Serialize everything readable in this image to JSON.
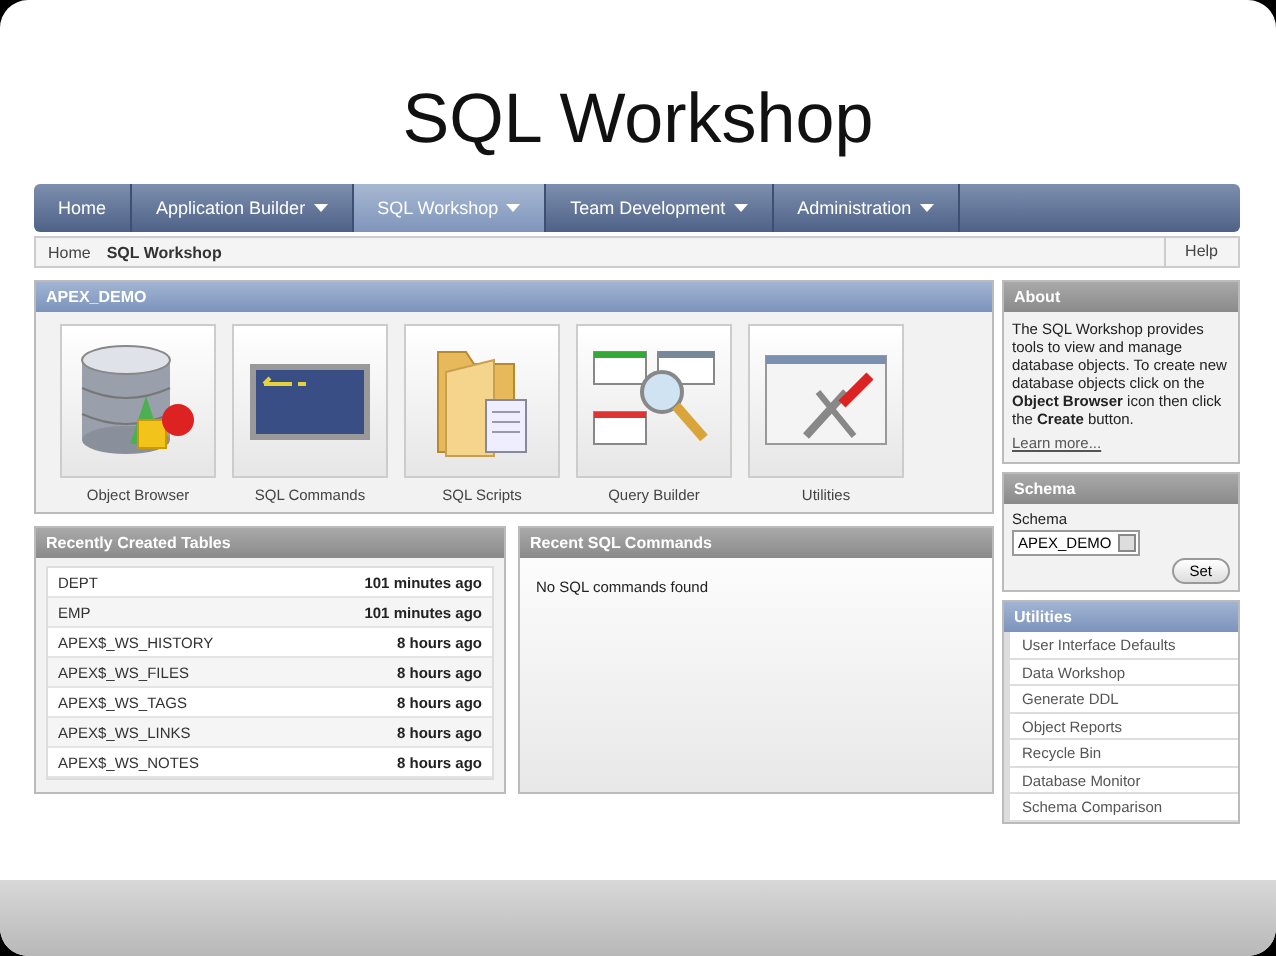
{
  "slide": {
    "title": "SQL Workshop"
  },
  "nav": {
    "tabs": [
      {
        "label": "Home",
        "dropdown": false,
        "selected": false
      },
      {
        "label": "Application Builder",
        "dropdown": true,
        "selected": false
      },
      {
        "label": "SQL Workshop",
        "dropdown": true,
        "selected": true
      },
      {
        "label": "Team Development",
        "dropdown": true,
        "selected": false
      },
      {
        "label": "Administration",
        "dropdown": true,
        "selected": false
      }
    ]
  },
  "breadcrumb": {
    "items": [
      "Home",
      "SQL Workshop"
    ],
    "help": "Help"
  },
  "workspace_panel": {
    "title": "APEX_DEMO",
    "tools": [
      {
        "label": "Object Browser",
        "kind": "database"
      },
      {
        "label": "SQL Commands",
        "kind": "console"
      },
      {
        "label": "SQL Scripts",
        "kind": "folder"
      },
      {
        "label": "Query Builder",
        "kind": "query"
      },
      {
        "label": "Utilities",
        "kind": "tools"
      }
    ]
  },
  "recent_tables": {
    "title": "Recently Created Tables",
    "rows": [
      {
        "name": "DEPT",
        "time": "101 minutes ago"
      },
      {
        "name": "EMP",
        "time": "101 minutes ago"
      },
      {
        "name": "APEX$_WS_HISTORY",
        "time": "8 hours ago"
      },
      {
        "name": "APEX$_WS_FILES",
        "time": "8 hours ago"
      },
      {
        "name": "APEX$_WS_TAGS",
        "time": "8 hours ago"
      },
      {
        "name": "APEX$_WS_LINKS",
        "time": "8 hours ago"
      },
      {
        "name": "APEX$_WS_NOTES",
        "time": "8 hours ago"
      }
    ]
  },
  "recent_commands": {
    "title": "Recent SQL Commands",
    "message": "No SQL commands found"
  },
  "about": {
    "title": "About",
    "text": "The SQL Workshop provides tools to view and manage database objects. To create new database objects click on the **Object Browser** icon then click the **Create** button.",
    "link": "Learn more..."
  },
  "schema": {
    "title": "Schema",
    "label": "Schema",
    "value": "APEX_DEMO",
    "button": "Set"
  },
  "utilities": {
    "title": "Utilities",
    "items": [
      "User Interface Defaults",
      "Data Workshop",
      "Generate DDL",
      "Object Reports",
      "Recycle Bin",
      "Database Monitor",
      "Schema Comparison"
    ]
  }
}
